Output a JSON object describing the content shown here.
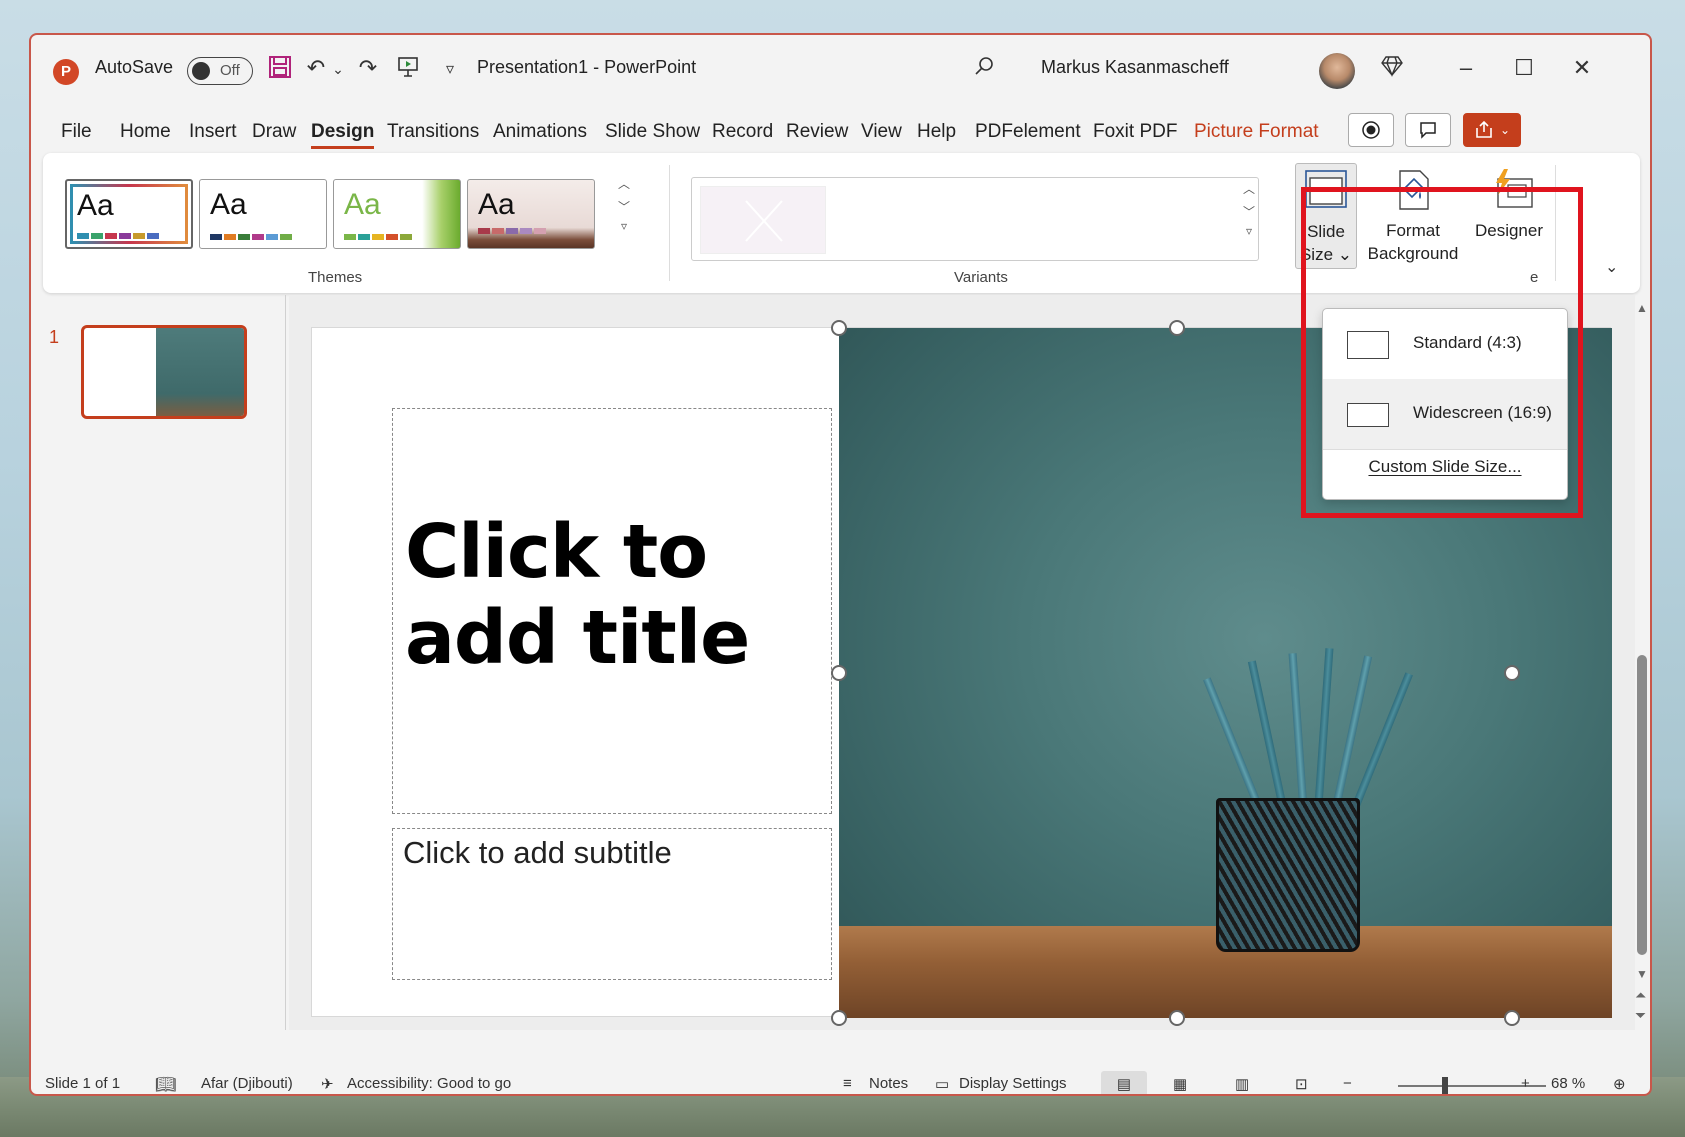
{
  "title_bar": {
    "app_icon": "powerpoint-icon",
    "autosave_label": "AutoSave",
    "autosave_state": "Off",
    "doc_title": "Presentation1  -  PowerPoint",
    "user_name": "Markus Kasanmascheff",
    "icons": [
      "save-icon",
      "undo-icon",
      "redo-icon",
      "present-icon",
      "customize-qat-icon",
      "search-icon",
      "diamond-icon",
      "minimize-icon",
      "maximize-icon",
      "close-icon"
    ]
  },
  "tabs": [
    "File",
    "Home",
    "Insert",
    "Draw",
    "Design",
    "Transitions",
    "Animations",
    "Slide Show",
    "Record",
    "Review",
    "View",
    "Help",
    "PDFelement",
    "Foxit PDF",
    "Picture Format"
  ],
  "active_tab": "Design",
  "ribbon": {
    "themes_label": "Themes",
    "theme_preview_text": "Aa",
    "variants_label": "Variants",
    "slide_size": [
      "Slide",
      "Size"
    ],
    "format_background": [
      "Format",
      "Background"
    ],
    "designer": "Designer",
    "designer_group_suffix": "e"
  },
  "dropdown": {
    "items": [
      "Standard (4:3)",
      "Widescreen (16:9)"
    ],
    "hovered": "Widescreen (16:9)",
    "custom": "Custom Slide Size..."
  },
  "slides_pane": {
    "slide_number": "1"
  },
  "slide": {
    "title_line1": "Click to",
    "title_line2": "add title",
    "subtitle": "Click to add subtitle"
  },
  "status_bar": {
    "slide_info": "Slide 1 of 1",
    "language": "Afar (Djibouti)",
    "accessibility": "Accessibility: Good to go",
    "notes": "Notes",
    "display_settings": "Display Settings",
    "zoom_minus": "−",
    "zoom_plus": "+",
    "zoom": "68 %"
  },
  "colors": {
    "accent": "#c43e1c",
    "highlight_box": "#e0141e"
  }
}
